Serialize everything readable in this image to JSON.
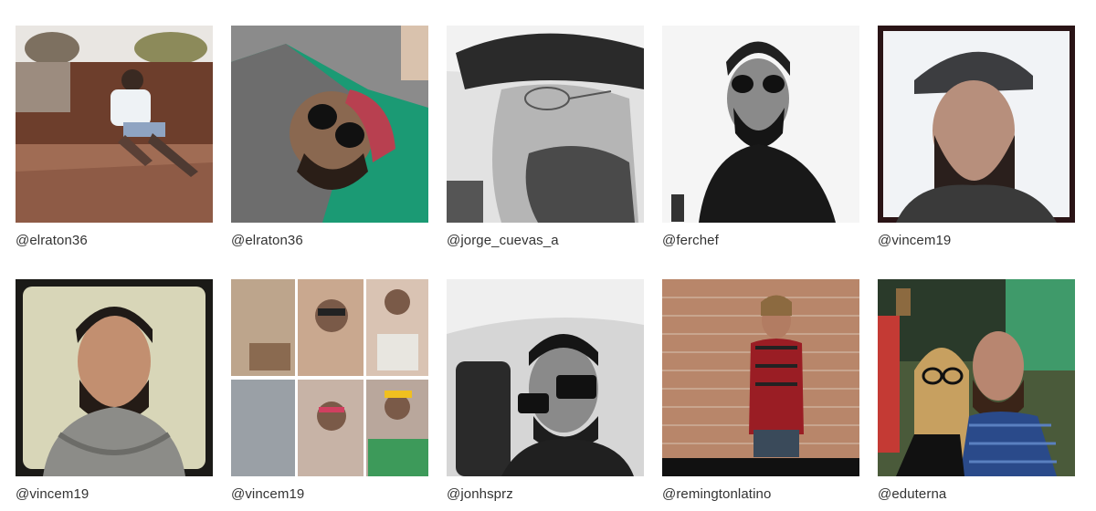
{
  "gallery": {
    "items": [
      {
        "handle": "@elraton36"
      },
      {
        "handle": "@elraton36"
      },
      {
        "handle": "@jorge_cuevas_a"
      },
      {
        "handle": "@ferchef"
      },
      {
        "handle": "@vincem19"
      },
      {
        "handle": "@vincem19"
      },
      {
        "handle": "@vincem19"
      },
      {
        "handle": "@jonhsprz"
      },
      {
        "handle": "@remingtonlatino"
      },
      {
        "handle": "@eduterna"
      }
    ],
    "colors": {
      "text": "#333333",
      "background": "#ffffff"
    }
  }
}
